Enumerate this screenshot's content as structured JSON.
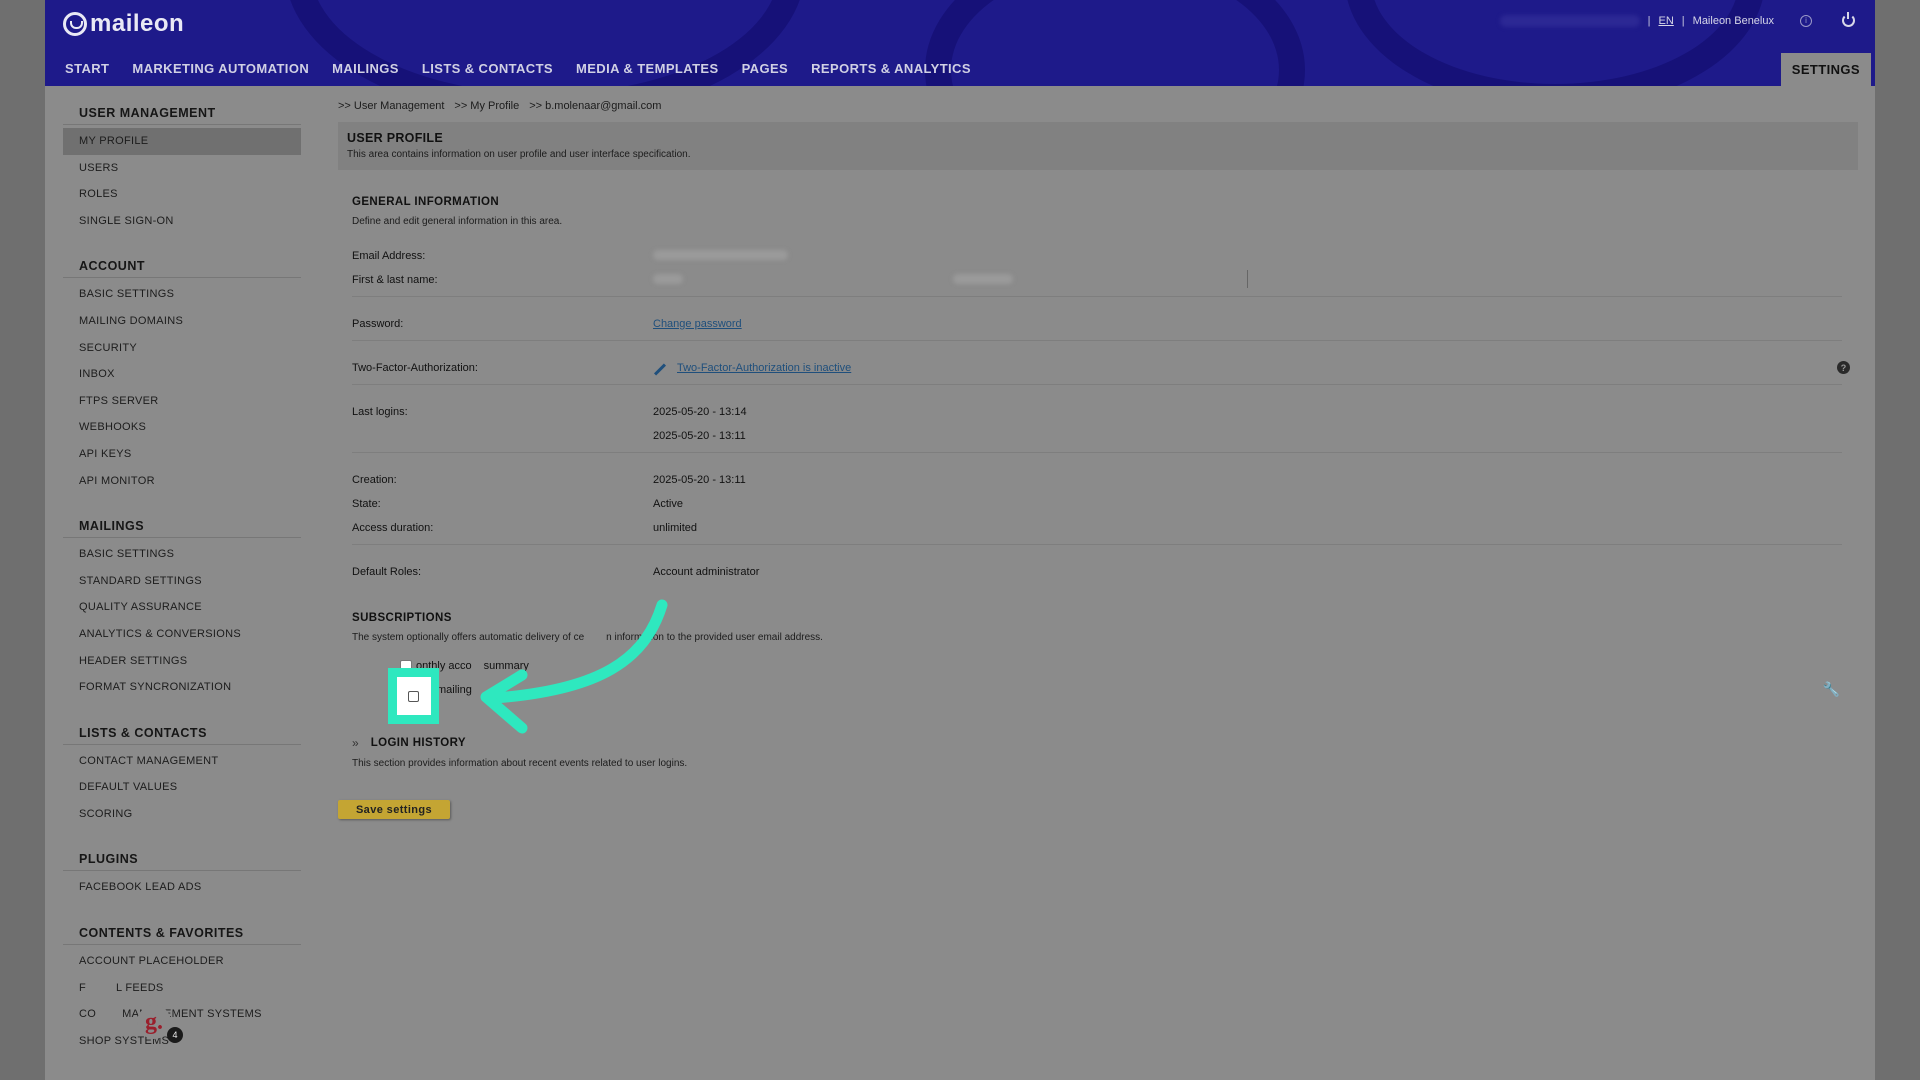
{
  "header": {
    "logo": "maileon",
    "lang": "EN",
    "account": "Maileon Benelux",
    "nav": [
      "START",
      "MARKETING AUTOMATION",
      "MAILINGS",
      "LISTS & CONTACTS",
      "MEDIA & TEMPLATES",
      "PAGES",
      "REPORTS & ANALYTICS"
    ],
    "settings_tab": "SETTINGS",
    "icons": [
      "info-icon",
      "power-icon"
    ]
  },
  "sidebar": {
    "groups": [
      {
        "title": "USER MANAGEMENT",
        "items": [
          "MY PROFILE",
          "USERS",
          "ROLES",
          "SINGLE SIGN-ON"
        ]
      },
      {
        "title": "ACCOUNT",
        "items": [
          "BASIC SETTINGS",
          "MAILING DOMAINS",
          "SECURITY",
          "INBOX",
          "FTPS SERVER",
          "WEBHOOKS",
          "API KEYS",
          "API MONITOR"
        ]
      },
      {
        "title": "MAILINGS",
        "items": [
          "BASIC SETTINGS",
          "STANDARD SETTINGS",
          "QUALITY ASSURANCE",
          "ANALYTICS & CONVERSIONS",
          "HEADER SETTINGS",
          "FORMAT SYNCRONIZATION"
        ]
      },
      {
        "title": "LISTS & CONTACTS",
        "items": [
          "CONTACT MANAGEMENT",
          "DEFAULT VALUES",
          "SCORING"
        ]
      },
      {
        "title": "PLUGINS",
        "items": [
          "FACEBOOK LEAD ADS"
        ]
      },
      {
        "title": "CONTENTS & FAVORITES",
        "items": [
          "ACCOUNT PLACEHOLDER",
          "F",
          "L FEEDS",
          "CO",
          "MANAGEMENT SYSTEMS",
          "SHOP SYSTEMS"
        ]
      }
    ],
    "active_item": "MY PROFILE"
  },
  "breadcrumb": [
    ">> User Management",
    ">> My Profile",
    ">> b.molenaar@gmail.com"
  ],
  "profile": {
    "title": "USER PROFILE",
    "subtitle": "This area contains information on user profile and user interface specification."
  },
  "general": {
    "title": "GENERAL INFORMATION",
    "desc": "Define and edit general information in this area.",
    "email_label": "Email Address:",
    "name_label": "First & last name:",
    "password_label": "Password:",
    "password_link": "Change password",
    "tfa_label": "Two-Factor-Authorization:",
    "tfa_link": "Two-Factor-Authorization is inactive",
    "last_logins_label": "Last logins:",
    "last_logins": [
      "2025-05-20 - 13:14",
      "2025-05-20 - 13:11"
    ],
    "creation_label": "Creation:",
    "creation": "2025-05-20 - 13:11",
    "state_label": "State:",
    "state": "Active",
    "access_label": "Access duration:",
    "access": "unlimited",
    "roles_label": "Default Roles:",
    "roles": "Account administrator"
  },
  "subscriptions": {
    "title": "SUBSCRIPTIONS",
    "desc_a": "The system optionally offers automatic delivery of ce",
    "desc_b": "n information to the provided user email address.",
    "monthly_a": "onthly acco",
    "monthly_b": "summary",
    "mailing": "mailing"
  },
  "login_history": {
    "title": "LOGIN HISTORY",
    "desc": "This section provides information about recent events related to user logins."
  },
  "save_button": "Save settings",
  "avatar": {
    "letter": "g.",
    "badge": "4"
  },
  "colors": {
    "header": "#1e1a8a",
    "highlight": "#2ee8bf",
    "save": "#c4a533",
    "link": "#1f4f7c"
  }
}
